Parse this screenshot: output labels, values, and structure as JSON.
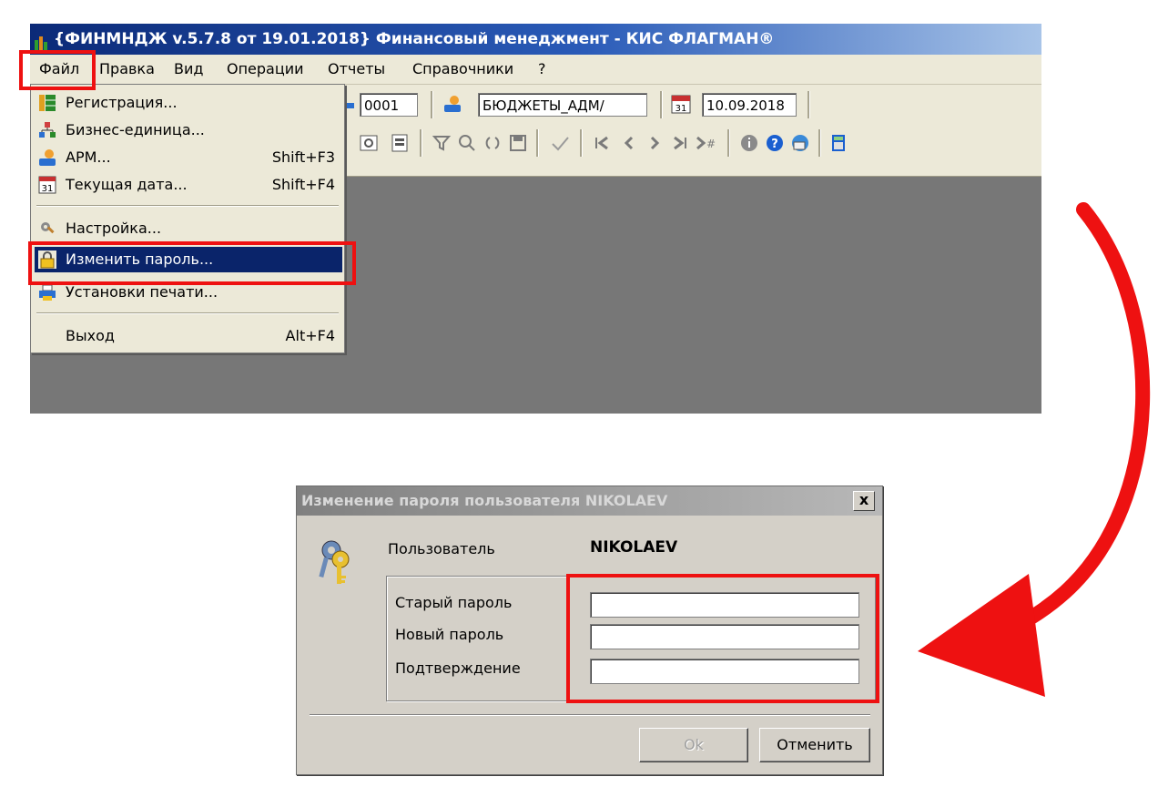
{
  "window": {
    "title": "{ФИНМНДЖ v.5.7.8 от 19.01.2018} Финансовый менеджмент - КИС ФЛАГМАН®"
  },
  "menubar": {
    "items": [
      {
        "label": "Файл"
      },
      {
        "label": "Правка"
      },
      {
        "label": "Вид"
      },
      {
        "label": "Операции"
      },
      {
        "label": "Отчеты"
      },
      {
        "label": "Справочники"
      },
      {
        "label": "?"
      }
    ]
  },
  "toolbar": {
    "business_unit_value": "0001",
    "workstation_value": "БЮДЖЕТЫ_АДМ/",
    "date_value": "10.09.2018",
    "icons": [
      "preview-icon",
      "print-icon",
      "filter-icon",
      "search-icon",
      "refresh-icon",
      "save-icon",
      "check-icon",
      "first-record-icon",
      "prev-record-icon",
      "next-record-icon",
      "last-record-icon",
      "goto-record-icon",
      "info-icon",
      "help-icon",
      "mail-icon",
      "calculator-icon"
    ]
  },
  "file_menu": {
    "items": [
      {
        "label": "Регистрация...",
        "shortcut": "",
        "icon": "registration-icon"
      },
      {
        "label": "Бизнес-единица...",
        "shortcut": "",
        "icon": "business-unit-icon"
      },
      {
        "label": "АРМ...",
        "shortcut": "Shift+F3",
        "icon": "workstation-icon"
      },
      {
        "label": "Текущая дата...",
        "shortcut": "Shift+F4",
        "icon": "calendar-icon"
      },
      {
        "label": "Настройка...",
        "shortcut": "",
        "icon": "settings-icon"
      },
      {
        "label": "Изменить пароль...",
        "shortcut": "",
        "icon": "lock-icon"
      },
      {
        "label": "Установки печати...",
        "shortcut": "",
        "icon": "printer-icon"
      },
      {
        "label": "Выход",
        "shortcut": "Alt+F4",
        "icon": ""
      }
    ],
    "calendar_badge": "31"
  },
  "dialog": {
    "title": "Изменение пароля пользователя NIKOLAEV",
    "close_label": "x",
    "user_label": "Пользователь",
    "user_value": "NIKOLAEV",
    "old_password_label": "Старый пароль",
    "new_password_label": "Новый пароль",
    "confirm_label": "Подтверждение",
    "old_password_value": "",
    "new_password_value": "",
    "confirm_value": "",
    "ok_label": "Ok",
    "cancel_label": "Отменить"
  },
  "colors": {
    "highlight": "#ee1111",
    "titlebar": "#0b2a78",
    "selection": "#0a246a",
    "workspace": "#777777"
  }
}
